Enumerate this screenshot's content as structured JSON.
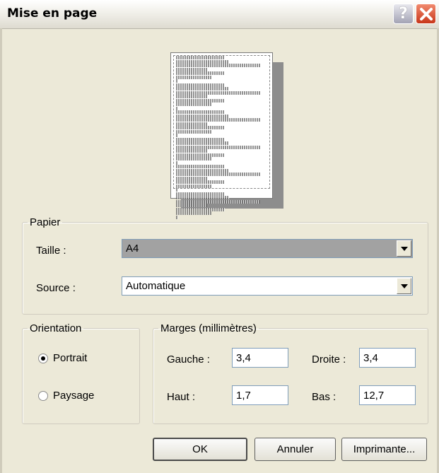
{
  "window": {
    "title": "Mise en page",
    "help_glyph": "?",
    "icons": [
      "help-icon",
      "close-icon"
    ]
  },
  "preview": {
    "line_count": 42
  },
  "paper": {
    "legend": "Papier",
    "size_label": "Taille :",
    "size_value": "A4",
    "source_label": "Source :",
    "source_value": "Automatique"
  },
  "orientation": {
    "legend": "Orientation",
    "portrait_label": "Portrait",
    "landscape_label": "Paysage",
    "selected": "Portrait"
  },
  "margins": {
    "legend": "Marges (millimètres)",
    "left_label": "Gauche :",
    "left_value": "3,4",
    "right_label": "Droite :",
    "right_value": "3,4",
    "top_label": "Haut :",
    "top_value": "1,7",
    "bottom_label": "Bas :",
    "bottom_value": "12,7"
  },
  "buttons": {
    "ok": "OK",
    "cancel": "Annuler",
    "printer": "Imprimante..."
  },
  "colors": {
    "dialog_bg": "#ece9d8",
    "close_button": "#d9462a",
    "selected_combo": "#a2a2a2"
  }
}
